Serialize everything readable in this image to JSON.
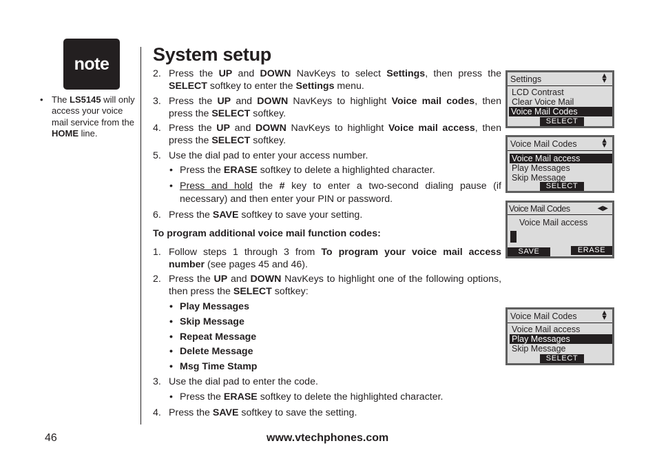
{
  "note": {
    "label": "note",
    "bullet": "•",
    "text_parts": [
      "The ",
      "LS5145",
      " will only access your voice mail service from the ",
      "HOME",
      " line."
    ]
  },
  "title": "System setup",
  "steps_part1": [
    {
      "num": "2.",
      "parts": [
        "Press the ",
        "UP",
        " and ",
        "DOWN",
        " NavKeys to select ",
        "Settings",
        ", then press the ",
        "SELECT",
        " softkey to enter the ",
        "Settings",
        " menu."
      ]
    },
    {
      "num": "3.",
      "parts": [
        "Press the ",
        "UP",
        " and ",
        "DOWN",
        " NavKeys to highlight ",
        "Voice mail codes",
        ", then press the ",
        "SELECT",
        " softkey."
      ]
    },
    {
      "num": "4.",
      "parts": [
        "Press the ",
        "UP",
        " and ",
        "DOWN",
        " NavKeys to highlight ",
        "Voice mail access",
        ", then press the ",
        "SELECT",
        " softkey."
      ]
    },
    {
      "num": "5.",
      "text": "Use the dial pad to enter your access number."
    },
    {
      "num": "6.",
      "parts": [
        "Press the ",
        "SAVE",
        " softkey to save your setting."
      ]
    }
  ],
  "step5_bullets": [
    {
      "parts": [
        "Press the ",
        "ERASE",
        " softkey to delete a highlighted character."
      ]
    },
    {
      "parts": [
        "Press and hold",
        " the ",
        "#",
        " key to enter a two-second dialing pause (if necessary) and then enter your PIN or password."
      ]
    }
  ],
  "section_heading": "To program additional voice mail function codes:",
  "steps_part2": [
    {
      "num": "1.",
      "parts": [
        "Follow steps 1 through 3 from ",
        "To program your voice mail access number",
        " (see pages 45 and 46)."
      ]
    },
    {
      "num": "2.",
      "parts": [
        "Press the ",
        "UP",
        " and ",
        "DOWN",
        " NavKeys to highlight one of the following options, then press the ",
        "SELECT",
        " softkey:"
      ]
    },
    {
      "num": "3.",
      "text": "Use the dial pad to enter the code."
    },
    {
      "num": "4.",
      "parts": [
        "Press the ",
        "SAVE",
        " softkey to save the setting."
      ]
    }
  ],
  "options": [
    "Play Messages",
    "Skip Message",
    "Repeat Message",
    "Delete Message",
    "Msg Time Stamp"
  ],
  "step3_bullet": {
    "parts": [
      "Press the ",
      "ERASE",
      " softkey to delete the highlighted character."
    ]
  },
  "bullet": "•",
  "screens": [
    {
      "header": "Settings",
      "icon": "up-down-arrows",
      "rows": [
        "LCD Contrast",
        "Clear Voice Mail",
        "Voice Mail Codes"
      ],
      "selected": 2,
      "softkey": "SELECT"
    },
    {
      "header": "Voice Mail Codes",
      "icon": "up-down-arrows",
      "rows": [
        "Voice Mail access",
        "Play Messages",
        "Skip Message"
      ],
      "selected": 0,
      "softkey": "SELECT"
    },
    {
      "header": "Voice Mail Codes",
      "icon": "left-right-arrows",
      "rows": [
        "Voice Mail access"
      ],
      "softkey_left": "SAVE",
      "softkey_right": "ERASE"
    },
    {
      "header": "Voice Mail Codes",
      "icon": "up-down-arrows",
      "rows": [
        "Voice Mail access",
        "Play Messages",
        "Skip Message"
      ],
      "selected": 1,
      "softkey": "SELECT"
    }
  ],
  "icons": {
    "up_down": "▲▼",
    "left": "◀",
    "right": "▶"
  },
  "footer": {
    "page_number": "46",
    "url": "www.vtechphones.com"
  }
}
